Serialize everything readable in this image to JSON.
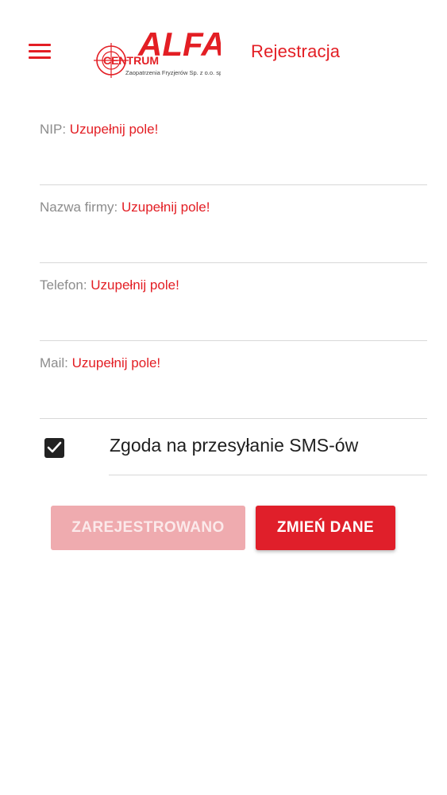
{
  "header": {
    "menu_icon": "hamburger-menu-icon",
    "logo": {
      "brand": "ALFA",
      "prefix": "CENTRUM",
      "tagline": "Zaopatrzenia Fryzjerów Sp. z o.o. sp.k."
    },
    "title": "Rejestracja"
  },
  "form": {
    "fields": [
      {
        "label": "NIP:",
        "error": "Uzupełnij pole!",
        "value": ""
      },
      {
        "label": "Nazwa firmy:",
        "error": "Uzupełnij pole!",
        "value": ""
      },
      {
        "label": "Telefon:",
        "error": "Uzupełnij pole!",
        "value": ""
      },
      {
        "label": "Mail:",
        "error": "Uzupełnij pole!",
        "value": ""
      }
    ],
    "sms_consent": {
      "label": "Zgoda na przesyłanie SMS-ów",
      "checked": true
    }
  },
  "buttons": {
    "registered_label": "ZAREJESTROWANO",
    "change_label": "ZMIEŃ DANE"
  },
  "colors": {
    "accent": "#e31e24",
    "disabled_button": "#efabaf",
    "label_gray": "#8c8c8c"
  }
}
